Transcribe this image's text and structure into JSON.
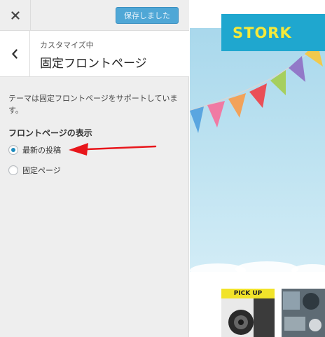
{
  "header": {
    "save_label": "保存しました"
  },
  "section": {
    "subtitle": "カスタマイズ中",
    "title": "固定フロントページ"
  },
  "content": {
    "description": "テーマは固定フロントページをサポートしています。",
    "group_title": "フロントページの表示",
    "options": [
      {
        "label": "最新の投稿",
        "checked": true
      },
      {
        "label": "固定ページ",
        "checked": false
      }
    ]
  },
  "preview": {
    "logo": "STORK",
    "pickup_label": "PICK UP"
  },
  "colors": {
    "accent": "#1e8cbe",
    "save_button": "#4fa7d6",
    "logo_bg": "#1fa7cf",
    "logo_text": "#f5e93a",
    "pickup_tag": "#f1e32a",
    "annotation_arrow": "#e8161b"
  },
  "icons": {
    "close": "close-icon",
    "back": "chevron-left-icon"
  }
}
